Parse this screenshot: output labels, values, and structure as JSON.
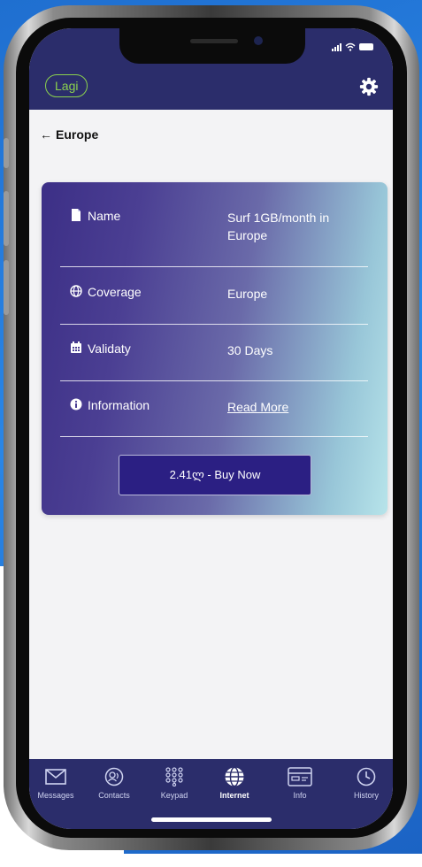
{
  "app": {
    "logo_text": "Lagi"
  },
  "header": {
    "back_arrow": "←",
    "title": "Europe"
  },
  "plan": {
    "rows": [
      {
        "icon": "document-icon",
        "label": "Name",
        "value": "Surf 1GB/month in Europe"
      },
      {
        "icon": "globe-icon",
        "label": "Coverage",
        "value": "Europe"
      },
      {
        "icon": "calendar-icon",
        "label": "Validaty",
        "value": "30 Days"
      },
      {
        "icon": "info-icon",
        "label": "Information",
        "value": "Read More"
      }
    ],
    "buy_label": "2.41ლ - Buy Now"
  },
  "tabs": [
    {
      "icon": "envelope-icon",
      "label": "Messages"
    },
    {
      "icon": "contacts-icon",
      "label": "Contacts"
    },
    {
      "icon": "keypad-icon",
      "label": "Keypad"
    },
    {
      "icon": "globe-icon",
      "label": "Internet",
      "active": true
    },
    {
      "icon": "card-icon",
      "label": "Info"
    },
    {
      "icon": "clock-icon",
      "label": "History"
    }
  ],
  "colors": {
    "bar": "#2b2d6b",
    "accent_logo": "#8bd14e",
    "button": "#2b1f83",
    "card_start": "#3c2f86",
    "card_end": "#b7e4ea"
  }
}
